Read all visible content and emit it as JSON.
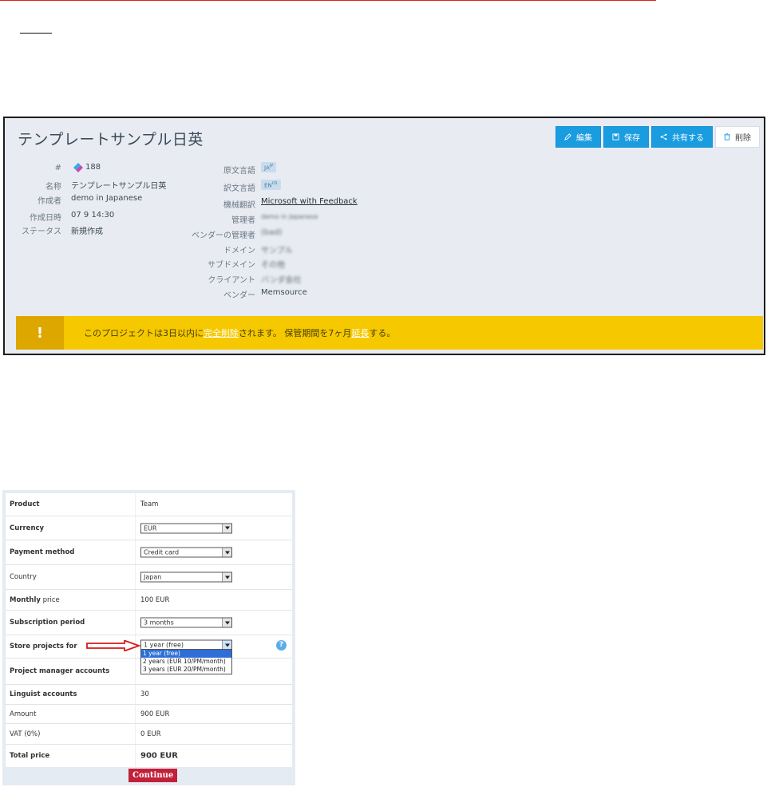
{
  "project": {
    "title": "テンプレートサンプル日英",
    "buttons": {
      "edit": "編集",
      "save": "保存",
      "share": "共有する",
      "delete": "削除"
    },
    "fields_left": [
      {
        "label": "#",
        "value": "188"
      },
      {
        "label": "名称",
        "value": "テンプレートサンプル日英"
      },
      {
        "label": "作成者",
        "value": "demo in Japanese"
      },
      {
        "label": "作成日時",
        "value": "07 9 14:30"
      },
      {
        "label": "ステータス",
        "value": "新規作成"
      }
    ],
    "fields_right": {
      "source_lang_label": "原文言語",
      "source_lang_value": "JA",
      "source_lang_sup": "JP",
      "target_lang_label": "訳文言語",
      "target_lang_value": "EN",
      "target_lang_sup": "US",
      "mt_label": "機械翻訳",
      "mt_value": "Microsoft with Feedback",
      "admin_label": "管理者",
      "admin_value": "demo in Japanese",
      "vendor_admin_label": "ベンダーの管理者",
      "vendor_admin_value": "(bad)",
      "domain_label": "ドメイン",
      "domain_value": "サンプル",
      "subdomain_label": "サブドメイン",
      "subdomain_value": "その他",
      "client_label": "クライアント",
      "client_value": "バンダ会社",
      "vendor_label": "ベンダー",
      "vendor_value": "Memsource"
    },
    "warning": {
      "icon": "!",
      "text_1": "このプロジェクトは3日以内に",
      "link_1": "完全削除",
      "text_2": "されます。 保管期間を7ヶ月",
      "link_2": "延長",
      "text_3": "する。"
    }
  },
  "order": {
    "rows": [
      {
        "label": "Product",
        "value": "Team"
      },
      {
        "label": "Currency",
        "select": "EUR"
      },
      {
        "label": "Payment method",
        "select": "Credit card"
      },
      {
        "label": "Country",
        "select": "Japan"
      },
      {
        "label_bold": "Monthly",
        "label_rest": " price",
        "value": "100 EUR"
      },
      {
        "label": "Subscription period",
        "select": "3 months"
      },
      {
        "label": "Store projects for",
        "select": "1 year (free)"
      },
      {
        "label": "Project manager accounts",
        "value": ""
      },
      {
        "label": "Linguist accounts",
        "value": "30"
      },
      {
        "label": "Amount",
        "value": "900 EUR"
      },
      {
        "label": "VAT (0%)",
        "value": "0 EUR"
      },
      {
        "label": "Total price",
        "value": "900 EUR"
      }
    ],
    "dropdown_options": [
      "1 year (free)",
      "2 years (EUR 10/PM/month)",
      "3 years (EUR 20/PM/month)"
    ],
    "help": "?",
    "continue_label": "Continue",
    "colors": {
      "accent_red": "#c2203a",
      "arrow_red": "#d71a1a",
      "link_blue": "#1a9de0",
      "warning_yellow": "#f5c800"
    }
  }
}
